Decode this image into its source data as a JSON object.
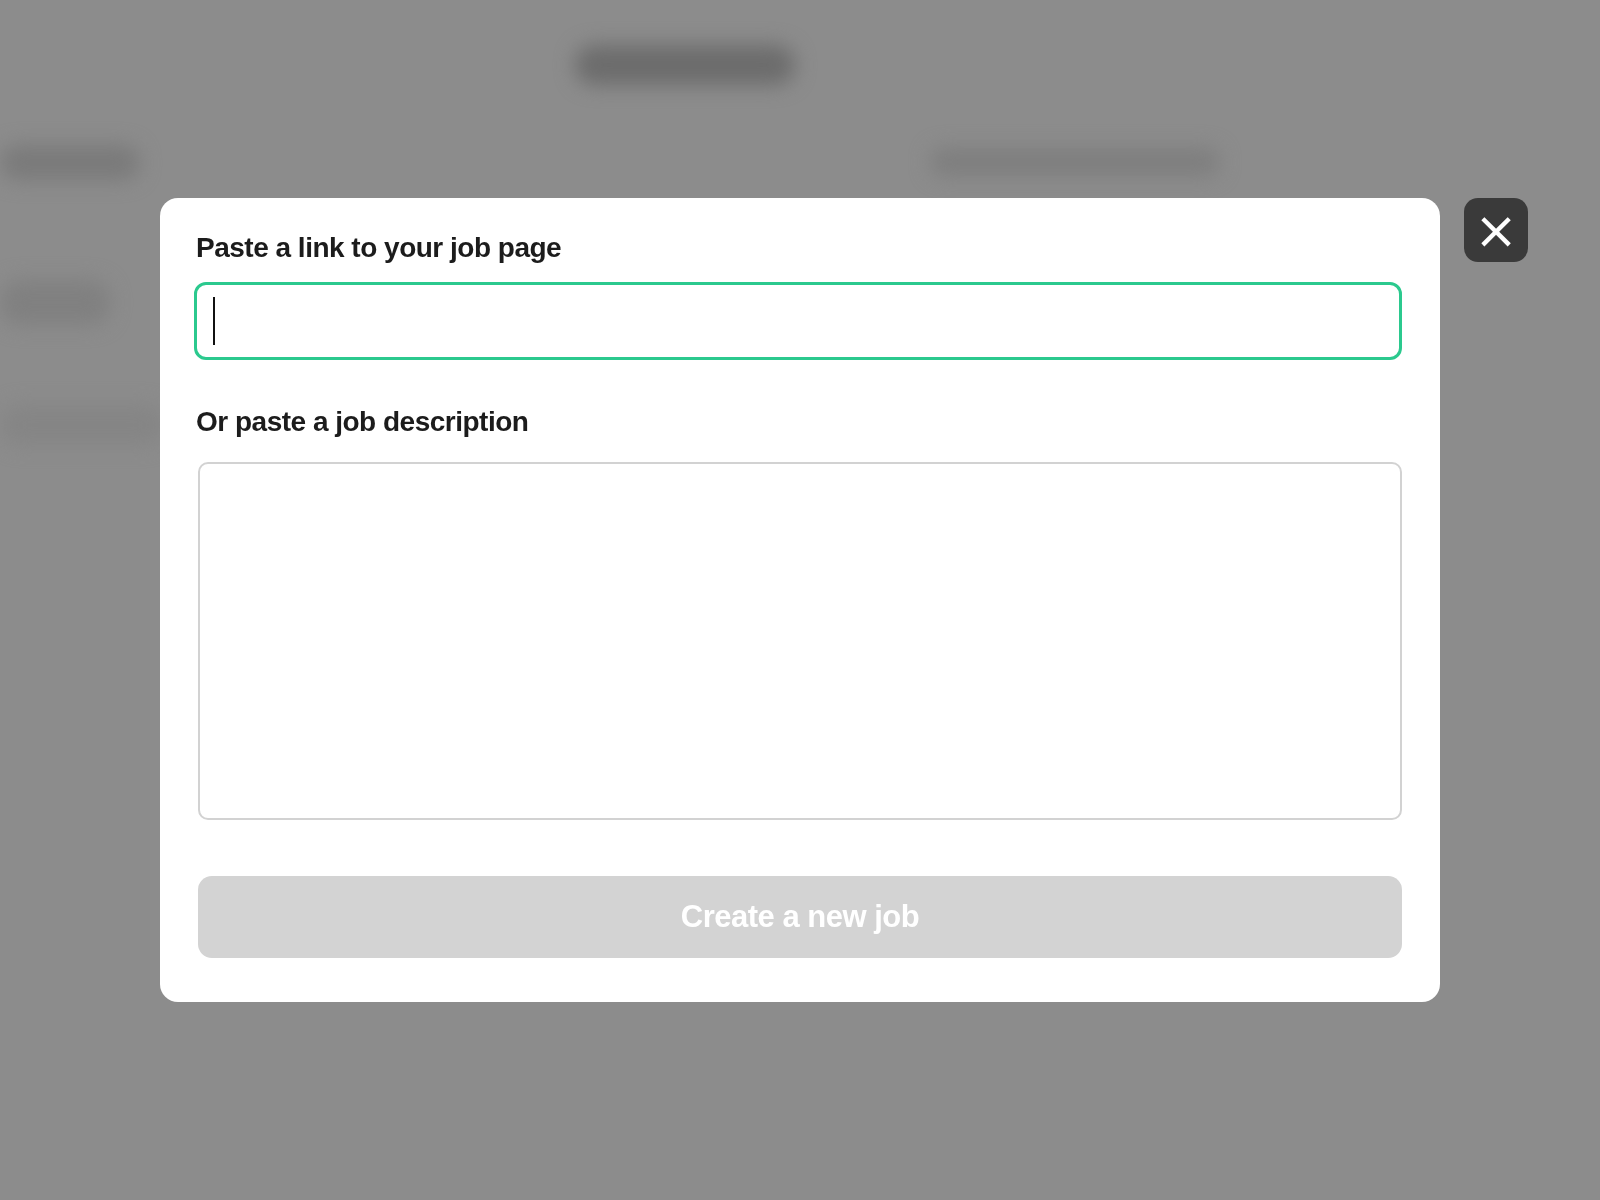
{
  "link_field": {
    "label": "Paste a link to your job page",
    "focused": true
  },
  "description_field": {
    "label": "Or paste a job description"
  },
  "submit_button": {
    "label": "Create a new job",
    "disabled": true
  },
  "close_button": {
    "label": "×"
  }
}
